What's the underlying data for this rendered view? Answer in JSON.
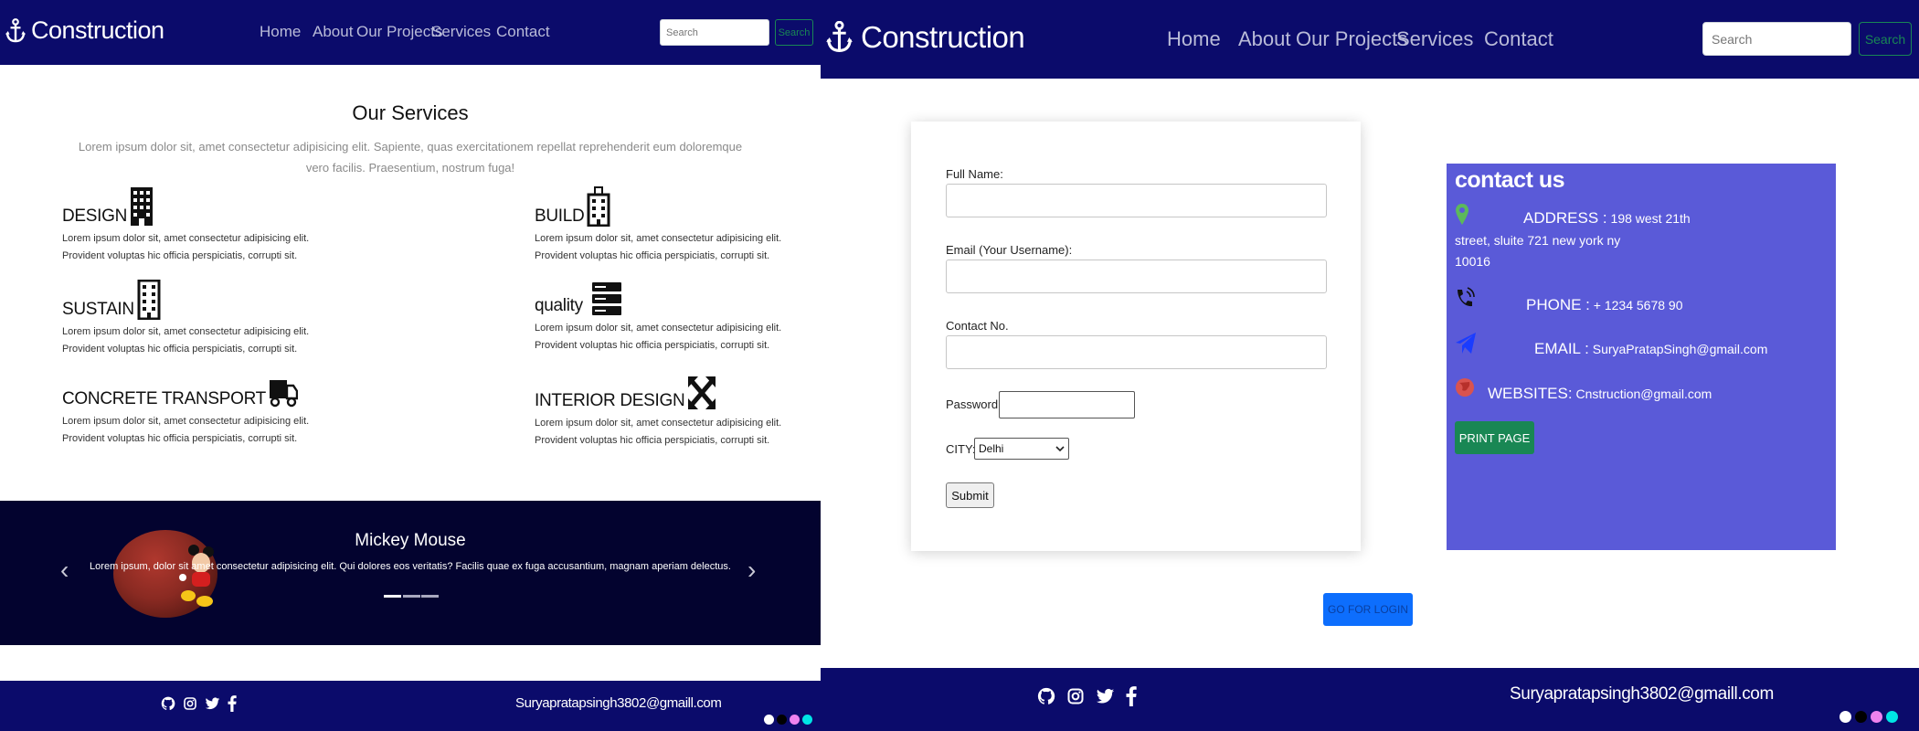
{
  "colors": {
    "navbar_bg": "#0b0b6b",
    "carousel_bg": "#03032f",
    "contact_bg": "#5a5ad8",
    "success_green": "#198754",
    "primary_blue": "#0d6efd",
    "theme_dots": [
      "#ffffff",
      "#000000",
      "#ee82ee",
      "#00e5e5"
    ]
  },
  "left": {
    "navbar": {
      "brand": "Construction",
      "brand_icon": "anchor-icon",
      "links": [
        "Home",
        "About",
        "Our Projects",
        "Services",
        "Contact"
      ],
      "search_placeholder": "Search",
      "search_button": "Search"
    },
    "services": {
      "title": "Our Services",
      "subtitle": "Lorem ipsum dolor sit, amet consectetur adipisicing elit. Sapiente, quas exercitationem repellat reprehenderit eum doloremque vero facilis. Praesentium, nostrum fuga!",
      "items": [
        {
          "name": "DESIGN",
          "icon": "building-icon",
          "desc1": "Lorem ipsum dolor sit, amet consectetur adipisicing elit.",
          "desc2": "Provident voluptas hic officia perspiciatis, corrupti sit."
        },
        {
          "name": "BUILD",
          "icon": "hotel-icon",
          "desc1": "Lorem ipsum dolor sit, amet consectetur adipisicing elit.",
          "desc2": "Provident voluptas hic officia perspiciatis, corrupti sit."
        },
        {
          "name": "SUSTAIN",
          "icon": "tower-icon",
          "desc1": "Lorem ipsum dolor sit, amet consectetur adipisicing elit.",
          "desc2": "Provident voluptas hic officia perspiciatis, corrupti sit."
        },
        {
          "name": "quality",
          "icon": "server-icon",
          "desc1": "Lorem ipsum dolor sit, amet consectetur adipisicing elit.",
          "desc2": "Provident voluptas hic officia perspiciatis, corrupti sit."
        },
        {
          "name": "CONCRETE TRANSPORT",
          "icon": "truck-icon",
          "desc1": "Lorem ipsum dolor sit, amet consectetur adipisicing elit.",
          "desc2": "Provident voluptas hic officia perspiciatis, corrupti sit."
        },
        {
          "name": "INTERIOR DESIGN",
          "icon": "expand-arrows-icon",
          "desc1": "Lorem ipsum dolor sit, amet consectetur adipisicing elit.",
          "desc2": "Provident voluptas hic officia perspiciatis, corrupti sit."
        }
      ]
    },
    "carousel": {
      "title": "Mickey Mouse",
      "text": "Lorem ipsum, dolor sit amet consectetur adipisicing elit. Qui dolores eos veritatis? Facilis quae ex fuga accusantium, magnam aperiam delectus.",
      "prev": "‹",
      "next": "›",
      "slide_count": 3,
      "active_slide": 1
    },
    "footer": {
      "icons": [
        "github-icon",
        "instagram-icon",
        "twitter-icon",
        "facebook-icon"
      ],
      "email": "Suryapratapsingh3802@gmaill.com"
    }
  },
  "right": {
    "navbar": {
      "brand": "Construction",
      "brand_icon": "anchor-icon",
      "links": [
        "Home",
        "About",
        "Our Projects",
        "Services",
        "Contact"
      ],
      "search_placeholder": "Search",
      "search_button": "Search"
    },
    "form": {
      "full_name_label": "Full Name:",
      "email_label": "Email (Your Username):",
      "contact_label": "Contact No.",
      "password_label": "Password:",
      "city_label": "CITY:",
      "city_value": "Delhi",
      "submit": "Submit"
    },
    "contact": {
      "title": "contact us",
      "address_key": "ADDRESS :",
      "address_line1": "198 west 21th",
      "address_line2": "street, sluite 721 new york ny",
      "address_line3": "10016",
      "phone_key": "PHONE :",
      "phone_value": "+ 1234 5678 90",
      "email_key": "EMAIL :",
      "email_value": "SuryaPratapSingh@gmail.com",
      "website_key": "WEBSITES:",
      "website_value": "Cnstruction@gmail.com",
      "print_button": "PRINT PAGE"
    },
    "login_button": "GO FOR LOGIN",
    "footer": {
      "icons": [
        "github-icon",
        "instagram-icon",
        "twitter-icon",
        "facebook-icon"
      ],
      "email": "Suryapratapsingh3802@gmaill.com"
    }
  }
}
